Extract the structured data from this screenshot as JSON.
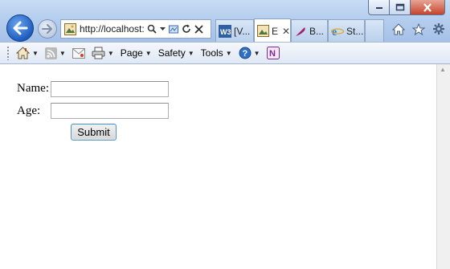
{
  "browser": {
    "address_url": "http://localhost:",
    "tabs": [
      {
        "label": "[V..."
      },
      {
        "label": "E"
      },
      {
        "label": "B..."
      },
      {
        "label": "St..."
      }
    ],
    "command_bar": {
      "page_label": "Page",
      "safety_label": "Safety",
      "tools_label": "Tools"
    }
  },
  "form": {
    "name_label": "Name:",
    "name_value": "",
    "age_label": "Age:",
    "age_value": "",
    "submit_label": "Submit"
  },
  "colors": {
    "frame": "#b4cdee",
    "back_button": "#1f5dbf",
    "close_button": "#c7442d"
  }
}
